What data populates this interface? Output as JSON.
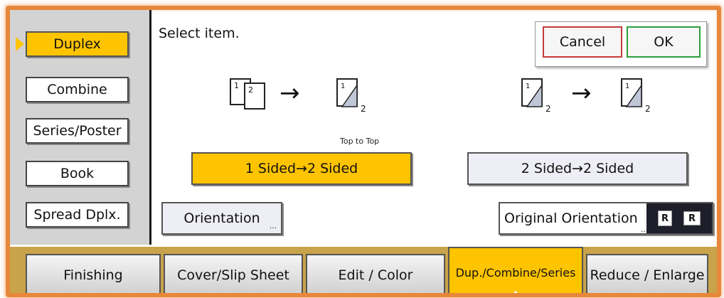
{
  "sidebar": {
    "items": [
      {
        "label": "Duplex"
      },
      {
        "label": "Combine"
      },
      {
        "label": "Series/Poster"
      },
      {
        "label": "Book"
      },
      {
        "label": "Spread Dplx."
      }
    ]
  },
  "main": {
    "prompt": "Select item.",
    "cancel_label": "Cancel",
    "ok_label": "OK",
    "top_to_top": "Top to Top",
    "option_1to2": "1 Sided→2 Sided",
    "option_2to2": "2 Sided→2 Sided",
    "orientation_label": "Orientation",
    "original_orientation_label": "Original Orientation",
    "icon_page1": "1",
    "icon_page2": "2",
    "icon_sub2": "2",
    "r_glyph": "R"
  },
  "tabs": [
    {
      "label": "Finishing"
    },
    {
      "label": "Cover/Slip Sheet"
    },
    {
      "label": "Edit / Color"
    },
    {
      "label": "Dup./Combine/Series"
    },
    {
      "label": "Reduce / Enlarge"
    }
  ],
  "colors": {
    "frame": "#e8873a",
    "active": "#ffc400",
    "cancel_border": "#c53a3a",
    "ok_border": "#2c9e3a"
  }
}
